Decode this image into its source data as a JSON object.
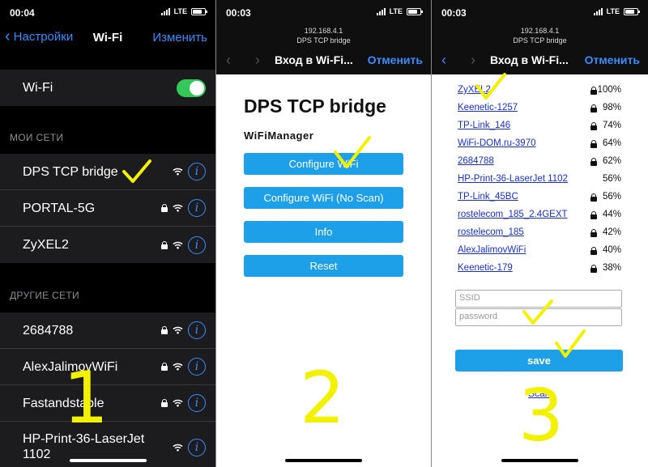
{
  "colors": {
    "accent": "#3a8dff",
    "toggle_on": "#34c759",
    "button": "#1ea0e8",
    "annotation": "#f1f100",
    "link": "#1a2fd0"
  },
  "panel1": {
    "status": {
      "time": "00:04",
      "network": "LTE"
    },
    "nav": {
      "back_label": "Настройки",
      "title": "Wi-Fi",
      "edit_label": "Изменить"
    },
    "wifi_toggle": {
      "label": "Wi-Fi",
      "on": true
    },
    "my_networks_header": "МОИ СЕТИ",
    "my_networks": [
      {
        "name": "DPS TCP bridge",
        "locked": false
      },
      {
        "name": "PORTAL-5G",
        "locked": true
      },
      {
        "name": "ZyXEL2",
        "locked": true
      }
    ],
    "other_networks_header": "ДРУГИЕ СЕТИ",
    "other_networks": [
      {
        "name": "2684788",
        "locked": true
      },
      {
        "name": "AlexJalimovWiFi",
        "locked": true
      },
      {
        "name": "Fastandstable",
        "locked": true
      },
      {
        "name": "HP-Print-36-LaserJet 1102",
        "locked": false
      }
    ],
    "step_number": "1"
  },
  "panel2": {
    "status": {
      "time": "00:03",
      "network": "LTE"
    },
    "header": {
      "url_line1": "192.168.4.1",
      "url_line2": "DPS TCP bridge",
      "title": "Вход в Wi-Fi...",
      "cancel_label": "Отменить"
    },
    "heading": "DPS TCP bridge",
    "subheading": "WiFiManager",
    "buttons": [
      "Configure WiFi",
      "Configure WiFi (No Scan)",
      "Info",
      "Reset"
    ],
    "step_number": "2"
  },
  "panel3": {
    "status": {
      "time": "00:03",
      "network": "LTE"
    },
    "header": {
      "url_line1": "192.168.4.1",
      "url_line2": "DPS TCP bridge",
      "title": "Вход в Wi-Fi...",
      "cancel_label": "Отменить"
    },
    "networks": [
      {
        "ssid": "ZyXEL2",
        "signal": "100%",
        "locked": true
      },
      {
        "ssid": "Keenetic-1257",
        "signal": "98%",
        "locked": true
      },
      {
        "ssid": "TP-Link_146",
        "signal": "74%",
        "locked": true
      },
      {
        "ssid": "WiFi-DOM.ru-3970",
        "signal": "64%",
        "locked": true
      },
      {
        "ssid": "2684788",
        "signal": "62%",
        "locked": true
      },
      {
        "ssid": "HP-Print-36-LaserJet 1102",
        "signal": "56%",
        "locked": false
      },
      {
        "ssid": "TP-Link_45BC",
        "signal": "56%",
        "locked": true
      },
      {
        "ssid": "rostelecom_185_2.4GEXT",
        "signal": "44%",
        "locked": true
      },
      {
        "ssid": "rostelecom_185",
        "signal": "42%",
        "locked": true
      },
      {
        "ssid": "AlexJalimovWiFi",
        "signal": "40%",
        "locked": true
      },
      {
        "ssid": "Keenetic-179",
        "signal": "38%",
        "locked": true
      }
    ],
    "ssid_placeholder": "SSID",
    "password_placeholder": "password",
    "save_label": "save",
    "scan_label": "Scan",
    "step_number": "3"
  }
}
